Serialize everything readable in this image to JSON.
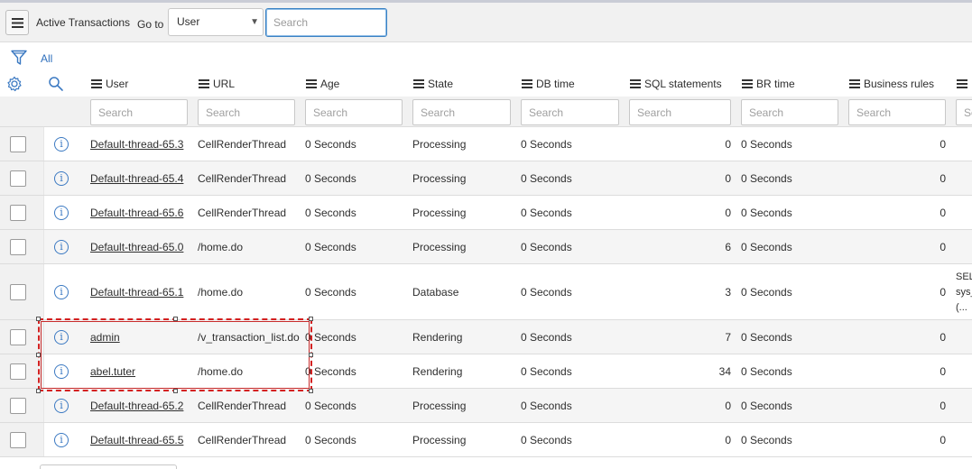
{
  "toolbar": {
    "title": "Active Transactions",
    "goto_label": "Go to",
    "goto_select_value": "User",
    "search_placeholder": "Search"
  },
  "filter": {
    "label": "All"
  },
  "columns": [
    {
      "label": "User",
      "search_placeholder": "Search"
    },
    {
      "label": "URL",
      "search_placeholder": "Search"
    },
    {
      "label": "Age",
      "search_placeholder": "Search"
    },
    {
      "label": "State",
      "search_placeholder": "Search"
    },
    {
      "label": "DB time",
      "search_placeholder": "Search"
    },
    {
      "label": "SQL statements",
      "search_placeholder": "Search"
    },
    {
      "label": "BR time",
      "search_placeholder": "Search"
    },
    {
      "label": "Business rules",
      "search_placeholder": "Search"
    },
    {
      "label": "",
      "search_placeholder": "Se"
    }
  ],
  "rows": [
    {
      "user": "Default-thread-65.3",
      "url": "CellRenderThread",
      "age": "0 Seconds",
      "state": "Processing",
      "db_time": "0 Seconds",
      "sql": "0",
      "br_time": "0 Seconds",
      "rules": "0"
    },
    {
      "user": "Default-thread-65.4",
      "url": "CellRenderThread",
      "age": "0 Seconds",
      "state": "Processing",
      "db_time": "0 Seconds",
      "sql": "0",
      "br_time": "0 Seconds",
      "rules": "0"
    },
    {
      "user": "Default-thread-65.6",
      "url": "CellRenderThread",
      "age": "0 Seconds",
      "state": "Processing",
      "db_time": "0 Seconds",
      "sql": "0",
      "br_time": "0 Seconds",
      "rules": "0"
    },
    {
      "user": "Default-thread-65.0",
      "url": "/home.do",
      "age": "0 Seconds",
      "state": "Processing",
      "db_time": "0 Seconds",
      "sql": "6",
      "br_time": "0 Seconds",
      "rules": "0"
    },
    {
      "user": "Default-thread-65.1",
      "url": "/home.do",
      "age": "0 Seconds",
      "state": "Database",
      "db_time": "0 Seconds",
      "sql": "3",
      "br_time": "0 Seconds",
      "rules": "0",
      "overflow": [
        "SEL",
        "sys_",
        "(..."
      ]
    },
    {
      "user": "admin",
      "url": "/v_transaction_list.do",
      "age": "0 Seconds",
      "state": "Rendering",
      "db_time": "0 Seconds",
      "sql": "7",
      "br_time": "0 Seconds",
      "rules": "0"
    },
    {
      "user": "abel.tuter",
      "url": "/home.do",
      "age": "0 Seconds",
      "state": "Rendering",
      "db_time": "0 Seconds",
      "sql": "34",
      "br_time": "0 Seconds",
      "rules": "0"
    },
    {
      "user": "Default-thread-65.2",
      "url": "CellRenderThread",
      "age": "0 Seconds",
      "state": "Processing",
      "db_time": "0 Seconds",
      "sql": "0",
      "br_time": "0 Seconds",
      "rules": "0"
    },
    {
      "user": "Default-thread-65.5",
      "url": "CellRenderThread",
      "age": "0 Seconds",
      "state": "Processing",
      "db_time": "0 Seconds",
      "sql": "0",
      "br_time": "0 Seconds",
      "rules": "0"
    }
  ],
  "colors": {
    "accent": "#3b79c2",
    "highlight_border": "#d42020",
    "toolbar_bg": "#f1f1f1"
  },
  "icons": {
    "menu": "hamburger-menu-icon",
    "filter": "funnel-icon",
    "settings": "gear-icon",
    "search": "magnifier-icon",
    "info": "info-circle-icon",
    "column_menu": "column-menu-icon"
  }
}
